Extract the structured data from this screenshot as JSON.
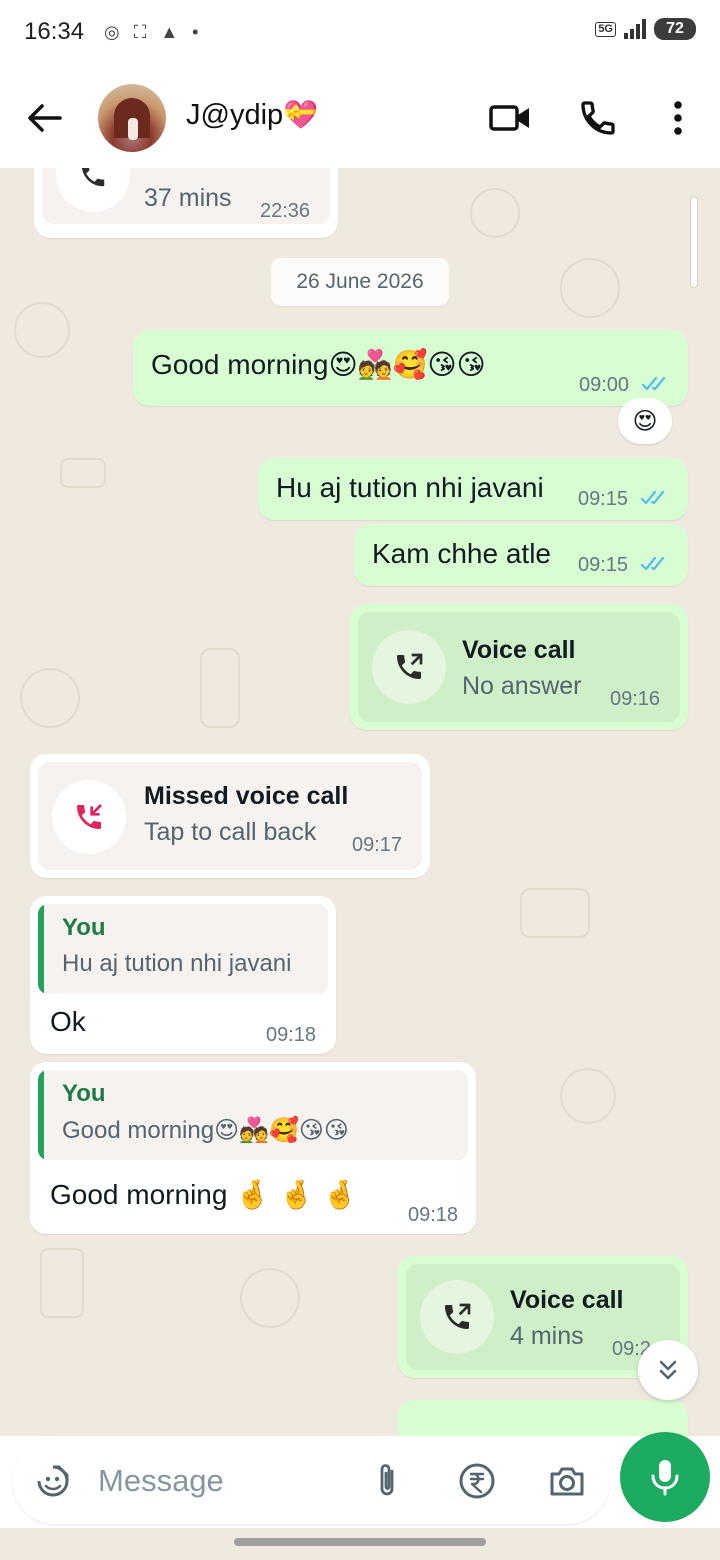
{
  "status_bar": {
    "time": "16:34",
    "network": "5G",
    "battery": "72"
  },
  "header": {
    "contact_name": "J@ydip",
    "name_emoji": "💝"
  },
  "messages": {
    "m0": {
      "subtitle": "37 mins",
      "time": "22:36"
    },
    "date_chip": "26 June 2026",
    "m1": {
      "text": "Good morning",
      "emojis": "😍💑🥰😘😘",
      "time": "09:00",
      "reaction": "😍"
    },
    "m2": {
      "text": "Hu aj tution nhi javani",
      "time": "09:15"
    },
    "m3": {
      "text": "Kam chhe atle",
      "time": "09:15"
    },
    "m4": {
      "title": "Voice call",
      "subtitle": "No answer",
      "time": "09:16"
    },
    "m5": {
      "title": "Missed voice call",
      "subtitle": "Tap to call back",
      "time": "09:17"
    },
    "m6": {
      "quote_author": "You",
      "quote_text": "Hu aj tution nhi javani",
      "text": "Ok",
      "time": "09:18"
    },
    "m7": {
      "quote_author": "You",
      "quote_text": "Good morning😍💑🥰😘😘",
      "text": "Good morning",
      "emojis": "🤞 🤞 🤞",
      "time": "09:18"
    },
    "m8": {
      "title": "Voice call",
      "subtitle": "4 mins",
      "time": "09:2"
    }
  },
  "composer": {
    "placeholder": "Message"
  },
  "icons": [
    "back-arrow-icon",
    "video-call-icon",
    "phone-icon",
    "more-options-icon",
    "outgoing-call-icon",
    "missed-call-icon",
    "sticker-icon",
    "attach-icon",
    "rupee-payment-icon",
    "camera-icon",
    "mic-icon",
    "scroll-down-icon"
  ],
  "colors": {
    "outgoing_bubble": "#d9fdd3",
    "incoming_bubble": "#ffffff",
    "chat_bg": "#efe9e0",
    "accent_green": "#1daa61",
    "read_ticks": "#53bdeb",
    "missed_call_red": "#e0245e"
  }
}
